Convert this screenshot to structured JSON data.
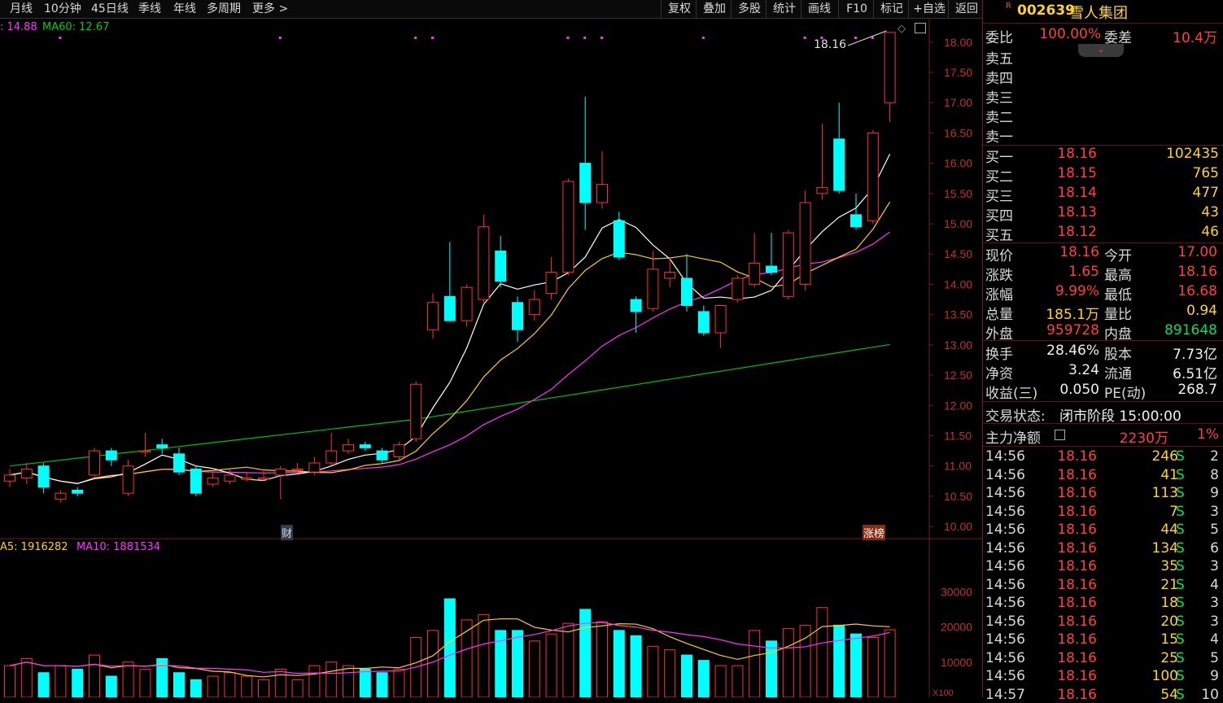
{
  "toolbar": {
    "left_items": [
      "月线",
      "10分钟",
      "45日线",
      "季线",
      "年线",
      "多周期",
      "更多 >"
    ],
    "right_items": [
      "复权",
      "叠加",
      "多股",
      "统计",
      "画线",
      "F10",
      "标记",
      "+自选",
      "返回"
    ]
  },
  "indicators": {
    "price_ma_text_1": ": 14.88",
    "price_ma_text_2": "MA60: 12.67",
    "vol_ma5": "A5: 1916282",
    "vol_ma10": "MA10: 1881534",
    "high_callout": "18.16",
    "markers": {
      "cai": "财",
      "zhangbang": "涨榜"
    }
  },
  "chart_data": {
    "type": "candlestick",
    "y_ticks": [
      "18.00",
      "17.50",
      "17.00",
      "16.50",
      "16.00",
      "15.50",
      "15.00",
      "14.50",
      "14.00",
      "13.50",
      "13.00",
      "12.50",
      "12.00",
      "11.50",
      "11.00",
      "10.50",
      "10.00"
    ],
    "vol_ticks": [
      "30000",
      "20000",
      "10000"
    ],
    "vol_unit": "X100",
    "candles": [
      {
        "o": 10.75,
        "c": 10.85,
        "h": 10.95,
        "l": 10.65,
        "v": 9000
      },
      {
        "o": 10.8,
        "c": 10.95,
        "h": 11.05,
        "l": 10.7,
        "v": 11000
      },
      {
        "o": 11.0,
        "c": 10.65,
        "h": 11.05,
        "l": 10.55,
        "v": 7000
      },
      {
        "o": 10.45,
        "c": 10.55,
        "h": 10.6,
        "l": 10.4,
        "v": 9000
      },
      {
        "o": 10.6,
        "c": 10.55,
        "h": 10.65,
        "l": 10.5,
        "v": 8000
      },
      {
        "o": 10.85,
        "c": 11.25,
        "h": 11.3,
        "l": 10.8,
        "v": 12000
      },
      {
        "o": 11.25,
        "c": 11.1,
        "h": 11.3,
        "l": 11.0,
        "v": 6000
      },
      {
        "o": 10.55,
        "c": 11.0,
        "h": 11.1,
        "l": 10.5,
        "v": 10000
      },
      {
        "o": 11.25,
        "c": 11.25,
        "h": 11.55,
        "l": 11.15,
        "v": 8000
      },
      {
        "o": 11.35,
        "c": 11.3,
        "h": 11.45,
        "l": 11.2,
        "v": 11000
      },
      {
        "o": 11.2,
        "c": 10.9,
        "h": 11.3,
        "l": 10.85,
        "v": 7000
      },
      {
        "o": 10.95,
        "c": 10.55,
        "h": 11.0,
        "l": 10.5,
        "v": 5000
      },
      {
        "o": 10.7,
        "c": 10.8,
        "h": 10.9,
        "l": 10.65,
        "v": 6000
      },
      {
        "o": 10.75,
        "c": 10.85,
        "h": 10.95,
        "l": 10.7,
        "v": 7000
      },
      {
        "o": 10.8,
        "c": 10.8,
        "h": 10.9,
        "l": 10.75,
        "v": 6000
      },
      {
        "o": 10.8,
        "c": 10.8,
        "h": 10.95,
        "l": 10.75,
        "v": 5000
      },
      {
        "o": 10.85,
        "c": 10.95,
        "h": 11.0,
        "l": 10.45,
        "v": 8000
      },
      {
        "o": 10.95,
        "c": 10.95,
        "h": 11.05,
        "l": 10.9,
        "v": 5000
      },
      {
        "o": 10.9,
        "c": 11.05,
        "h": 11.15,
        "l": 10.85,
        "v": 9000
      },
      {
        "o": 11.05,
        "c": 11.25,
        "h": 11.55,
        "l": 11.0,
        "v": 10000
      },
      {
        "o": 11.25,
        "c": 11.35,
        "h": 11.45,
        "l": 11.2,
        "v": 9000
      },
      {
        "o": 11.35,
        "c": 11.3,
        "h": 11.4,
        "l": 11.25,
        "v": 8000
      },
      {
        "o": 11.25,
        "c": 11.1,
        "h": 11.3,
        "l": 11.05,
        "v": 7000
      },
      {
        "o": 11.15,
        "c": 11.35,
        "h": 11.4,
        "l": 11.1,
        "v": 8000
      },
      {
        "o": 11.45,
        "c": 12.35,
        "h": 12.4,
        "l": 11.4,
        "v": 17000
      },
      {
        "o": 13.25,
        "c": 13.7,
        "h": 13.85,
        "l": 13.1,
        "v": 19000
      },
      {
        "o": 13.8,
        "c": 13.4,
        "h": 14.7,
        "l": 13.4,
        "v": 28000
      },
      {
        "o": 13.4,
        "c": 13.95,
        "h": 14.0,
        "l": 13.3,
        "v": 22000
      },
      {
        "o": 13.75,
        "c": 14.95,
        "h": 15.15,
        "l": 13.7,
        "v": 23500
      },
      {
        "o": 14.55,
        "c": 14.05,
        "h": 14.8,
        "l": 13.95,
        "v": 19000
      },
      {
        "o": 13.7,
        "c": 13.25,
        "h": 13.8,
        "l": 13.05,
        "v": 19000
      },
      {
        "o": 13.5,
        "c": 13.75,
        "h": 13.9,
        "l": 13.4,
        "v": 16000
      },
      {
        "o": 13.85,
        "c": 14.2,
        "h": 14.45,
        "l": 13.75,
        "v": 18000
      },
      {
        "o": 14.2,
        "c": 15.7,
        "h": 15.75,
        "l": 14.15,
        "v": 21000
      },
      {
        "o": 16.0,
        "c": 15.35,
        "h": 17.1,
        "l": 14.9,
        "v": 25000
      },
      {
        "o": 15.35,
        "c": 15.65,
        "h": 16.2,
        "l": 15.25,
        "v": 21500
      },
      {
        "o": 15.05,
        "c": 14.45,
        "h": 15.2,
        "l": 14.4,
        "v": 19000
      },
      {
        "o": 13.75,
        "c": 13.55,
        "h": 13.8,
        "l": 13.2,
        "v": 17500
      },
      {
        "o": 13.6,
        "c": 14.25,
        "h": 14.55,
        "l": 13.55,
        "v": 14500
      },
      {
        "o": 14.1,
        "c": 14.2,
        "h": 14.45,
        "l": 13.95,
        "v": 13500
      },
      {
        "o": 14.1,
        "c": 13.65,
        "h": 14.5,
        "l": 13.55,
        "v": 12000
      },
      {
        "o": 13.55,
        "c": 13.2,
        "h": 13.65,
        "l": 13.15,
        "v": 10500
      },
      {
        "o": 13.2,
        "c": 13.65,
        "h": 13.65,
        "l": 12.95,
        "v": 9000
      },
      {
        "o": 13.75,
        "c": 14.1,
        "h": 14.15,
        "l": 13.7,
        "v": 9000
      },
      {
        "o": 14.0,
        "c": 14.35,
        "h": 14.85,
        "l": 13.95,
        "v": 19000
      },
      {
        "o": 14.3,
        "c": 14.2,
        "h": 14.85,
        "l": 14.15,
        "v": 16000
      },
      {
        "o": 13.8,
        "c": 14.85,
        "h": 14.9,
        "l": 13.75,
        "v": 19500
      },
      {
        "o": 14.0,
        "c": 15.35,
        "h": 15.55,
        "l": 13.9,
        "v": 20500
      },
      {
        "o": 15.5,
        "c": 15.6,
        "h": 16.65,
        "l": 15.4,
        "v": 25500
      },
      {
        "o": 16.4,
        "c": 15.55,
        "h": 17.0,
        "l": 15.5,
        "v": 20500
      },
      {
        "o": 15.15,
        "c": 14.95,
        "h": 15.5,
        "l": 14.9,
        "v": 18000
      },
      {
        "o": 15.05,
        "c": 16.5,
        "h": 16.55,
        "l": 15.0,
        "v": 17000
      },
      {
        "o": 17.0,
        "c": 18.16,
        "h": 18.16,
        "l": 16.68,
        "v": 19200
      }
    ]
  },
  "right_panel": {
    "code": "002639",
    "name": "雪人集团",
    "r_badge": "R",
    "weibi_label": "委比",
    "weibi_val": "100.00%",
    "weicha_label": "委差",
    "weicha_val": "10.4万",
    "sell_labels": [
      "卖五",
      "卖四",
      "卖三",
      "卖二",
      "卖一"
    ],
    "buys": [
      {
        "label": "买一",
        "price": "18.16",
        "vol": "102435"
      },
      {
        "label": "买二",
        "price": "18.15",
        "vol": "765"
      },
      {
        "label": "买三",
        "price": "18.14",
        "vol": "477"
      },
      {
        "label": "买四",
        "price": "18.13",
        "vol": "43"
      },
      {
        "label": "买五",
        "price": "18.12",
        "vol": "46"
      }
    ],
    "stats": [
      {
        "l1": "现价",
        "v1": "18.16",
        "c1": "red",
        "l2": "今开",
        "v2": "17.00",
        "c2": "red"
      },
      {
        "l1": "涨跌",
        "v1": "1.65",
        "c1": "red",
        "l2": "最高",
        "v2": "18.16",
        "c2": "red"
      },
      {
        "l1": "涨幅",
        "v1": "9.99%",
        "c1": "red",
        "l2": "最低",
        "v2": "16.68",
        "c2": "red"
      },
      {
        "l1": "总量",
        "v1": "185.1万",
        "c1": "yel",
        "l2": "量比",
        "v2": "0.94",
        "c2": "yel"
      },
      {
        "l1": "外盘",
        "v1": "959728",
        "c1": "red",
        "l2": "内盘",
        "v2": "891648",
        "c2": "grn"
      }
    ],
    "stats2": [
      {
        "l1": "换手",
        "v1": "28.46%",
        "l2": "股本",
        "v2": "7.73亿"
      },
      {
        "l1": "净资",
        "v1": "3.24",
        "l2": "流通",
        "v2": "6.51亿"
      },
      {
        "l1": "收益(三)",
        "v1": "0.050",
        "l2": "PE(动)",
        "v2": "268.7"
      }
    ],
    "trade_status_label": "交易状态:",
    "trade_status_val": "闭市阶段 15:00:00",
    "main_force_label": "主力净额",
    "main_force_val": "2230万",
    "main_force_pct": "1%",
    "ticks": [
      {
        "t": "14:56",
        "p": "18.16",
        "v": "246",
        "s": "S",
        "n": "2"
      },
      {
        "t": "14:56",
        "p": "18.16",
        "v": "41",
        "s": "S",
        "n": "8"
      },
      {
        "t": "14:56",
        "p": "18.16",
        "v": "113",
        "s": "S",
        "n": "9"
      },
      {
        "t": "14:56",
        "p": "18.16",
        "v": "7",
        "s": "S",
        "n": "3"
      },
      {
        "t": "14:56",
        "p": "18.16",
        "v": "44",
        "s": "S",
        "n": "5"
      },
      {
        "t": "14:56",
        "p": "18.16",
        "v": "134",
        "s": "S",
        "n": "6"
      },
      {
        "t": "14:56",
        "p": "18.16",
        "v": "35",
        "s": "S",
        "n": "3"
      },
      {
        "t": "14:56",
        "p": "18.16",
        "v": "21",
        "s": "S",
        "n": "4"
      },
      {
        "t": "14:56",
        "p": "18.16",
        "v": "18",
        "s": "S",
        "n": "3"
      },
      {
        "t": "14:56",
        "p": "18.16",
        "v": "20",
        "s": "S",
        "n": "3"
      },
      {
        "t": "14:56",
        "p": "18.16",
        "v": "15",
        "s": "S",
        "n": "4"
      },
      {
        "t": "14:56",
        "p": "18.16",
        "v": "25",
        "s": "S",
        "n": "5"
      },
      {
        "t": "14:56",
        "p": "18.16",
        "v": "100",
        "s": "S",
        "n": "9"
      },
      {
        "t": "14:57",
        "p": "18.16",
        "v": "54",
        "s": "S",
        "n": "10"
      }
    ]
  },
  "colors": {
    "up": "#ff3030",
    "down": "#00ffff",
    "ma5": "#ffffff",
    "ma10": "#ffd200",
    "ma20": "#ff33ff",
    "ma60": "#00c000"
  }
}
